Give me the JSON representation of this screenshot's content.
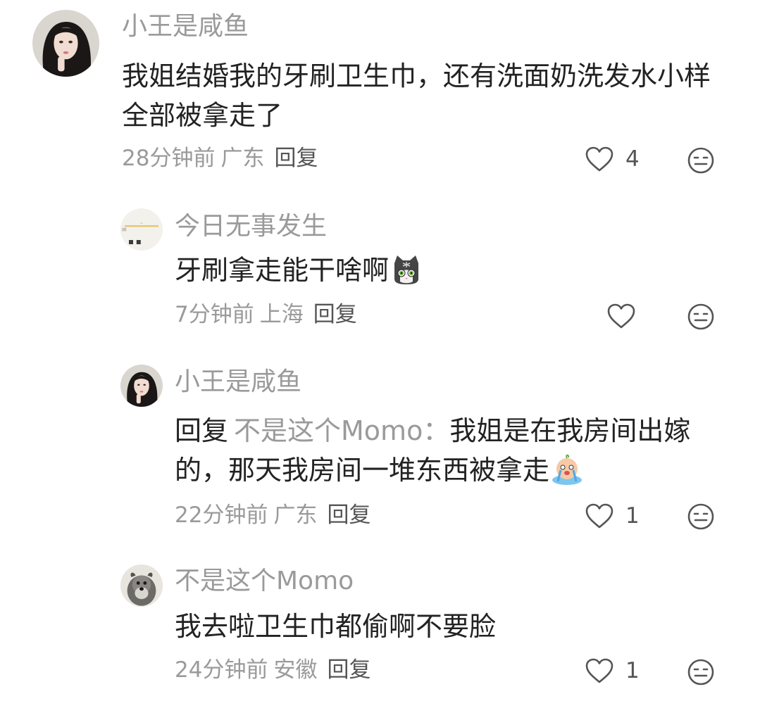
{
  "comments": [
    {
      "username": "小王是咸鱼",
      "text": "我姐结婚我的牙刷卫生巾，还有洗面奶洗发水小样全部被拿走了",
      "time": "28分钟前",
      "location": "广东",
      "reply_label": "回复",
      "likes": "4",
      "replies": [
        {
          "username": "今日无事发生",
          "text": "牙刷拿走能干啥啊",
          "emoji": "cat-emoji",
          "time": "7分钟前",
          "location": "上海",
          "reply_label": "回复",
          "likes": ""
        },
        {
          "username": "小王是咸鱼",
          "reply_prefix": "回复",
          "mention": "不是这个Momo：",
          "text": "我姐是在我房间出嫁的，那天我房间一堆东西被拿走",
          "emoji": "crying-emoji",
          "time": "22分钟前",
          "location": "广东",
          "reply_label": "回复",
          "likes": "1"
        },
        {
          "username": "不是这个Momo",
          "text": "我去啦卫生巾都偷啊不要脸",
          "time": "24分钟前",
          "location": "安徽",
          "reply_label": "回复",
          "likes": "1"
        }
      ]
    }
  ],
  "colors": {
    "name": "#9a9a9a",
    "text": "#222222",
    "meta": "#9a9a9a",
    "icon": "#555555",
    "background": "#ffffff"
  }
}
